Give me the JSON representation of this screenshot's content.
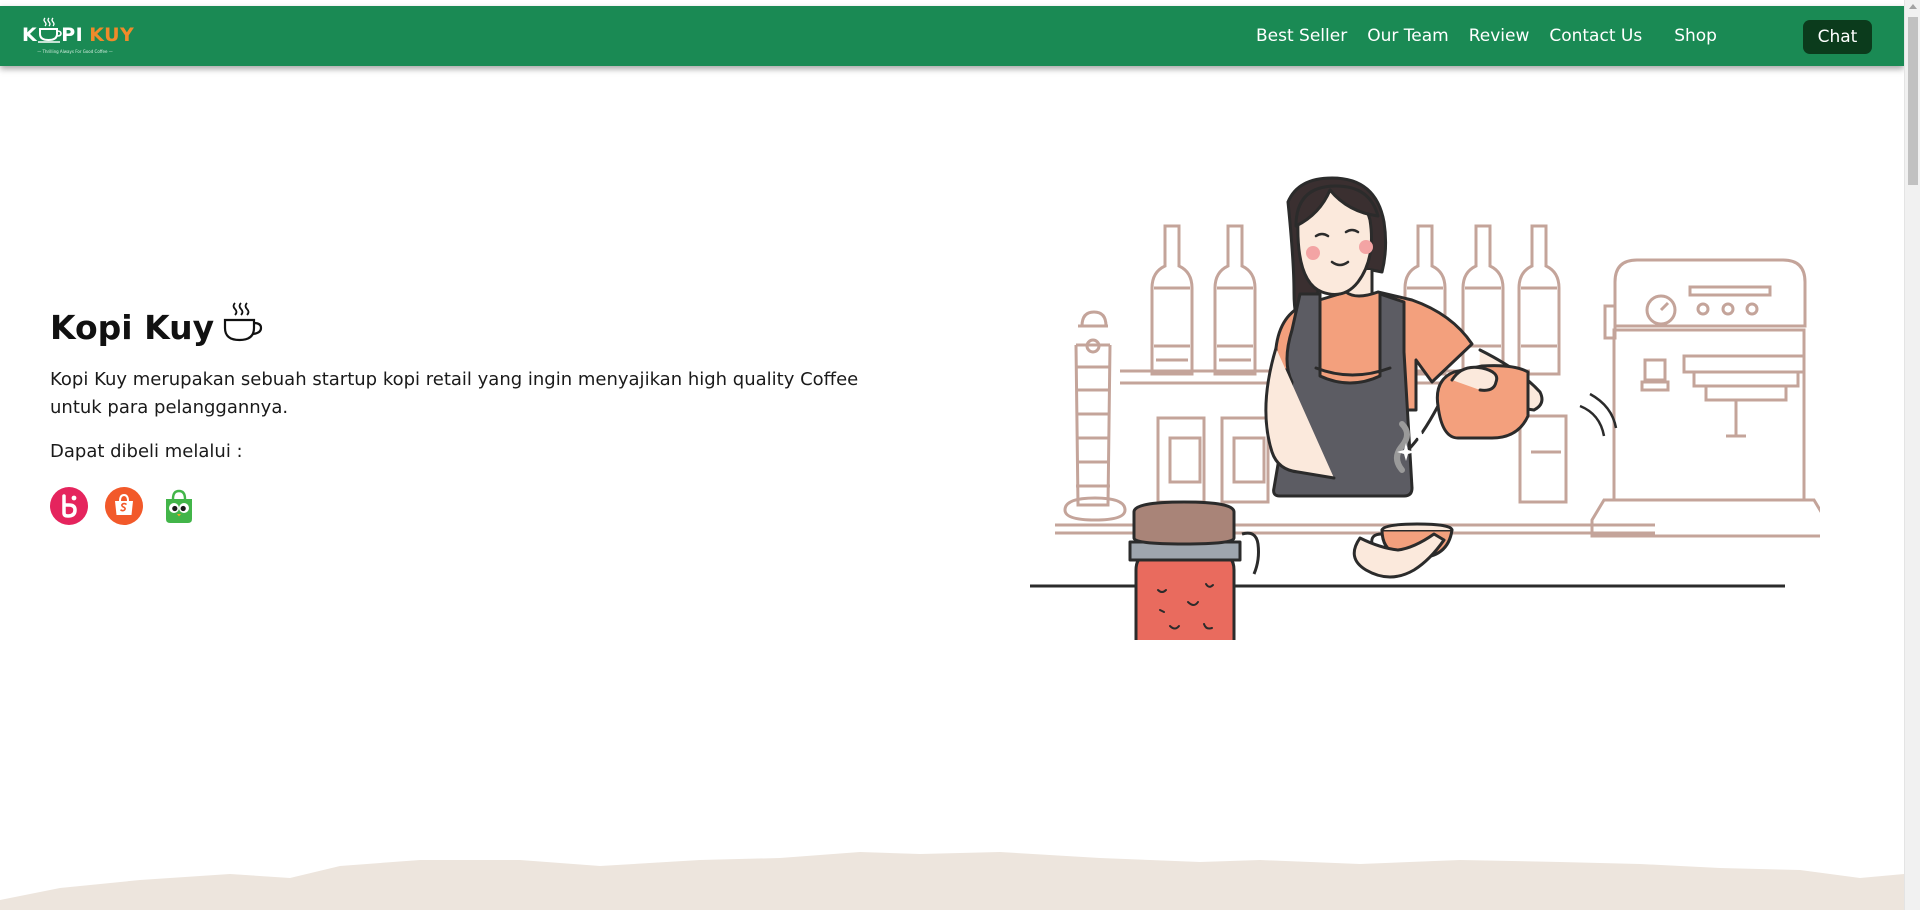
{
  "brand": {
    "logo_k": "K",
    "logo_pi": "PI",
    "logo_kuy": "KUY",
    "tagline": "— Thrilling Always For Good Coffee —"
  },
  "nav": {
    "items": [
      "Best Seller",
      "Our Team",
      "Review",
      "Contact Us",
      "Shop"
    ],
    "chat_label": "Chat"
  },
  "hero": {
    "title": "Kopi Kuy",
    "description": "Kopi Kuy merupakan sebuah startup kopi retail yang ingin menyajikan high quality Coffee untuk para pelanggannya.",
    "buy_label": "Dapat dibeli melalui :",
    "stores": [
      {
        "icon": "blibli-icon",
        "color": "#e5245d"
      },
      {
        "icon": "shopee-icon",
        "color": "#f2592a"
      },
      {
        "icon": "tokopedia-icon",
        "color": "#42b549"
      }
    ]
  },
  "colors": {
    "navbar": "#1a8a54",
    "chat_button": "#0b3b1c",
    "brand_accent": "#f08a2a",
    "footer_wave": "#ede5dd"
  }
}
